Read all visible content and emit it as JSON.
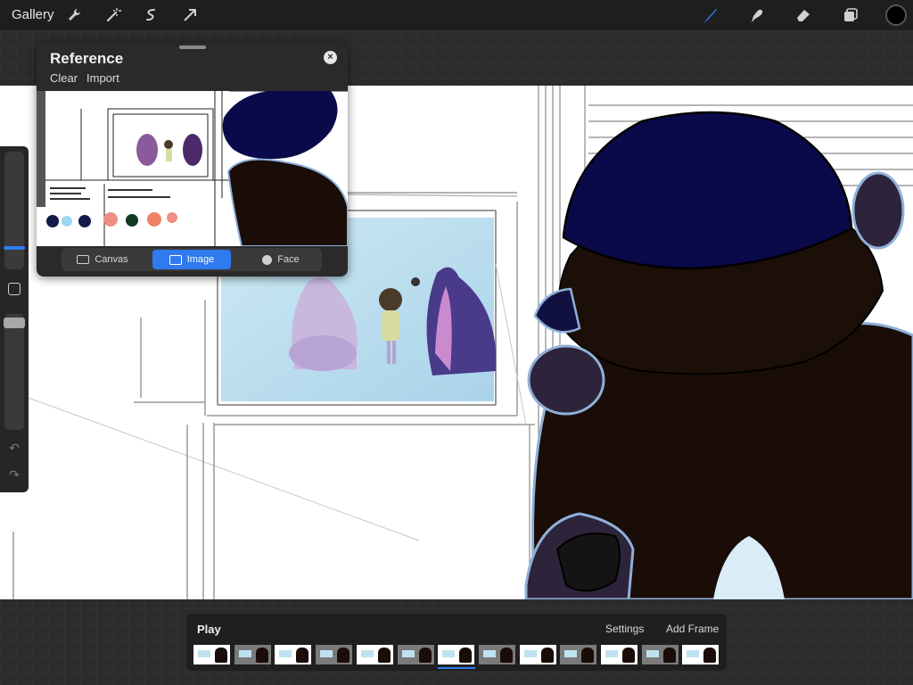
{
  "topbar": {
    "gallery_label": "Gallery",
    "left_tools": [
      "wrench-icon",
      "magic-wand-icon",
      "selection-icon",
      "transform-arrow-icon"
    ],
    "right_tools": [
      "brush-icon",
      "smudge-icon",
      "eraser-icon",
      "layers-icon",
      "color-swatch"
    ],
    "active_tool": "brush",
    "accent_color": "#2f7af0",
    "current_color": "#000000"
  },
  "reference": {
    "title": "Reference",
    "clear_label": "Clear",
    "import_label": "Import",
    "close_symbol": "×",
    "tabs": [
      {
        "label": "Canvas",
        "icon": "canvas-icon",
        "active": false
      },
      {
        "label": "Image",
        "icon": "image-icon",
        "active": true
      },
      {
        "label": "Face",
        "icon": "face-icon",
        "active": false
      }
    ]
  },
  "sidebar": {
    "brush_size_fraction": 0.75,
    "opacity_fraction": 0.05,
    "undo_icon": "undo-icon",
    "redo_icon": "redo-icon"
  },
  "timeline": {
    "play_label": "Play",
    "settings_label": "Settings",
    "add_frame_label": "Add Frame",
    "frame_count": 13,
    "selected_frame": 7
  }
}
